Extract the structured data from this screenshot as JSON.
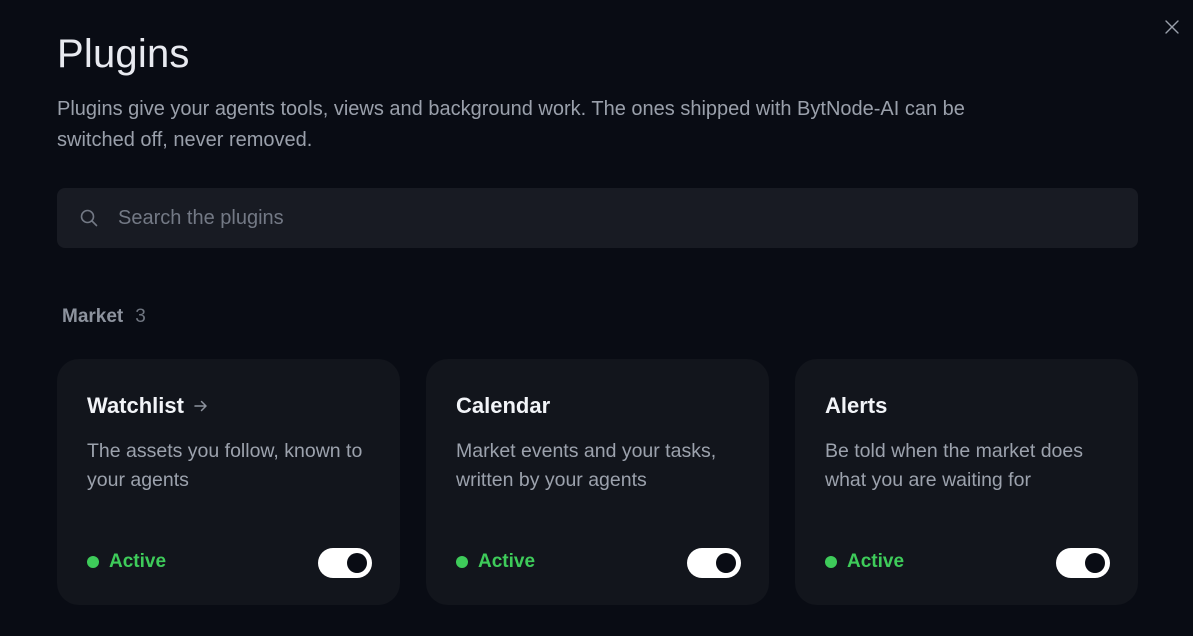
{
  "header": {
    "title": "Plugins",
    "description": "Plugins give your agents tools, views and background work. The ones shipped with BytNode-AI can be switched off, never removed."
  },
  "search": {
    "placeholder": "Search the plugins",
    "value": ""
  },
  "section": {
    "name": "Market",
    "count": "3"
  },
  "cards": [
    {
      "title": "Watchlist",
      "has_arrow": true,
      "description": "The assets you follow, known to your agents",
      "status": "Active",
      "enabled": true
    },
    {
      "title": "Calendar",
      "has_arrow": false,
      "description": "Market events and your tasks, written by your agents",
      "status": "Active",
      "enabled": true
    },
    {
      "title": "Alerts",
      "has_arrow": false,
      "description": "Be told when the market does what you are waiting for",
      "status": "Active",
      "enabled": true
    }
  ],
  "colors": {
    "background": "#090c14",
    "card": "#12151c",
    "active": "#3ecb5a",
    "toggle_on": "#ffffff"
  },
  "icons": {
    "close": "close-icon",
    "search": "search-icon",
    "arrow": "arrow-right-icon"
  }
}
